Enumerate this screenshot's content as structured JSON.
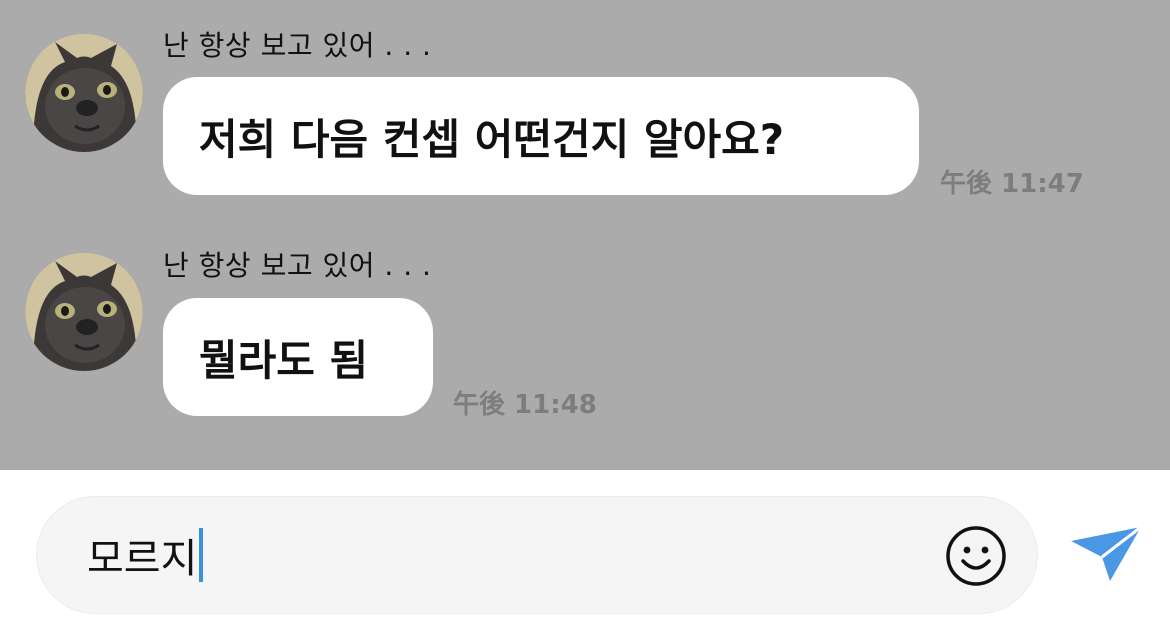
{
  "messages": [
    {
      "sender": "난 항상 보고 있어 . . .",
      "text": "저희 다음 컨셉 어떤건지 알아요?",
      "time": "午後 11:47"
    },
    {
      "sender": "난 항상 보고 있어 . . .",
      "text": "뭘라도 됨",
      "time": "午後 11:48"
    }
  ],
  "composer": {
    "value": "모르지",
    "emoji_icon": "smiley-icon",
    "send_icon": "paper-plane-icon",
    "send_color": "#4a97e3"
  },
  "colors": {
    "chat_background": "#ababab",
    "bubble": "#ffffff",
    "timestamp": "#7d7d7d",
    "caret": "#3d8fe0"
  }
}
